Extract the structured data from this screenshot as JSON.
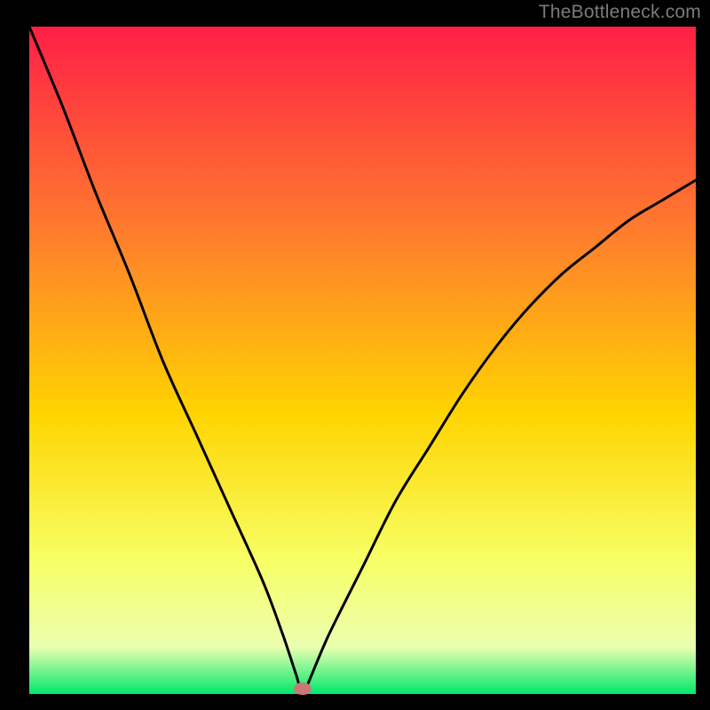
{
  "attribution": "TheBottleneck.com",
  "chart_data": {
    "type": "line",
    "title": "",
    "xlabel": "",
    "ylabel": "",
    "xlim": [
      0,
      100
    ],
    "ylim": [
      0,
      100
    ],
    "curve_description": "V-shaped bottleneck curve with minimum near x≈41",
    "x": [
      0,
      5,
      10,
      15,
      20,
      25,
      30,
      35,
      38,
      40,
      41,
      42,
      45,
      50,
      55,
      60,
      65,
      70,
      75,
      80,
      85,
      90,
      95,
      100
    ],
    "values": [
      100,
      88,
      75,
      63,
      50,
      39,
      28,
      17,
      9,
      3,
      0,
      2,
      9,
      19,
      29,
      37,
      45,
      52,
      58,
      63,
      67,
      71,
      74,
      77
    ],
    "marker": {
      "x": 41,
      "y": 0,
      "color": "#c77a73"
    },
    "gradient_colors": {
      "top": "#ff1f46",
      "upper_mid": "#ff7a2e",
      "mid": "#ffd400",
      "lower_mid": "#f7ff66",
      "low": "#eaffb0",
      "bottom": "#00e86b"
    }
  }
}
